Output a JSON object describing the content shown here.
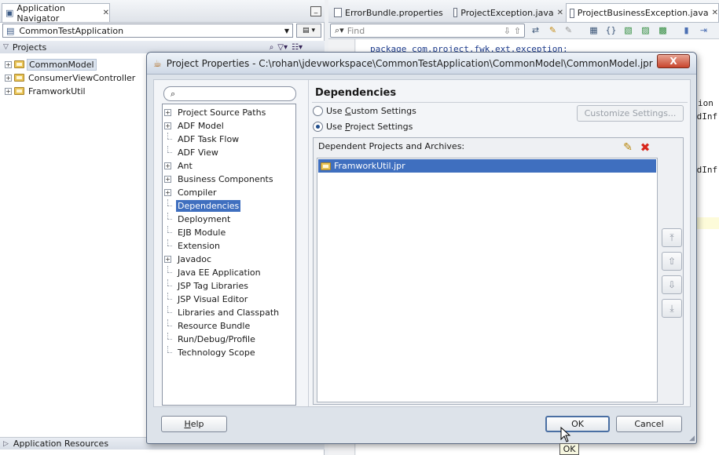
{
  "navigator": {
    "tab_label": "Application Navigator",
    "app_name": "CommonTestApplication",
    "projects_label": "Projects",
    "projects": [
      {
        "name": "CommonModel",
        "selected": true
      },
      {
        "name": "ConsumerViewController",
        "selected": false
      },
      {
        "name": "FramworkUtil",
        "selected": false
      }
    ],
    "app_resources_label": "Application Resources"
  },
  "editor": {
    "tabs": [
      {
        "label": "ErrorBundle.properties",
        "active": false
      },
      {
        "label": "ProjectException.java",
        "active": false
      },
      {
        "label": "ProjectBusinessException.java",
        "active": true
      }
    ],
    "find_placeholder": "Find",
    "code_fragments": [
      "package com.project.fwk.ext.exception;",
      "ion",
      "edInf",
      "edInf"
    ]
  },
  "dialog": {
    "title": "Project Properties - C:\\rohan\\jdevworkspace\\CommonTestApplication\\CommonModel\\CommonModel.jpr",
    "close_label": "X",
    "categories": [
      {
        "label": "Project Source Paths",
        "expandable": true
      },
      {
        "label": "ADF Model",
        "expandable": true
      },
      {
        "label": "ADF Task Flow",
        "expandable": false
      },
      {
        "label": "ADF View",
        "expandable": false
      },
      {
        "label": "Ant",
        "expandable": true
      },
      {
        "label": "Business Components",
        "expandable": true
      },
      {
        "label": "Compiler",
        "expandable": true
      },
      {
        "label": "Dependencies",
        "expandable": false,
        "selected": true
      },
      {
        "label": "Deployment",
        "expandable": false
      },
      {
        "label": "EJB Module",
        "expandable": false
      },
      {
        "label": "Extension",
        "expandable": false
      },
      {
        "label": "Javadoc",
        "expandable": true
      },
      {
        "label": "Java EE Application",
        "expandable": false
      },
      {
        "label": "JSP Tag Libraries",
        "expandable": false
      },
      {
        "label": "JSP Visual Editor",
        "expandable": false
      },
      {
        "label": "Libraries and Classpath",
        "expandable": false
      },
      {
        "label": "Resource Bundle",
        "expandable": false
      },
      {
        "label": "Run/Debug/Profile",
        "expandable": false
      },
      {
        "label": "Technology Scope",
        "expandable": false
      }
    ],
    "pane_title": "Dependencies",
    "use_custom_settings": {
      "before": "Use ",
      "mnemonic": "C",
      "after": "ustom Settings",
      "selected": false
    },
    "use_project_settings": {
      "before": "Use ",
      "mnemonic": "P",
      "after": "roject Settings",
      "selected": true
    },
    "customize_label": "Customize Settings...",
    "dependent_header": "Dependent Projects and Archives:",
    "dependent_items": [
      "FramworkUtil.jpr"
    ],
    "help": {
      "mnemonic": "H",
      "rest": "elp"
    },
    "ok_label": "OK",
    "cancel_label": "Cancel",
    "tooltip": "OK"
  },
  "colors": {
    "selection": "#3f6fbf",
    "close_button": "#c8452d",
    "delete_icon": "#d8261b"
  }
}
